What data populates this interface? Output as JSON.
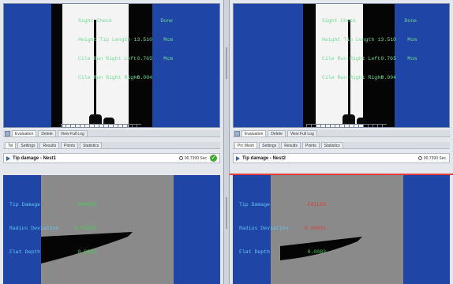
{
  "left": {
    "overlay": [
      {
        "label": "Sight Check",
        "value": "",
        "unit": "Done"
      },
      {
        "label": "Height Tip Length",
        "value": "13.510",
        "unit": "Mcm"
      },
      {
        "label": "Cile Run Right Left",
        "value": "0.765",
        "unit": "Mcm"
      },
      {
        "label": "Cile Run Right Right",
        "value": "-0.004",
        "unit": ""
      }
    ],
    "tabs_top": [
      "Evaluation",
      "Delete",
      "View Full Log"
    ],
    "tabs_bottom": [
      "Tol",
      "Settings",
      "Results",
      "Points",
      "Statistics"
    ],
    "title": "Tip damage - Nest1",
    "time": "00.7390 Sec",
    "status_icon": "check-circle-icon",
    "results": [
      {
        "label": "Tip Damage",
        "value": "PASSED",
        "color": "#44d14f"
      },
      {
        "label": "Radius Deviation",
        "value": "0.00236",
        "color": "#44d14f"
      },
      {
        "label": "Flat Depth",
        "value": "0.0083",
        "color": "#44d14f"
      }
    ]
  },
  "right": {
    "overlay": [
      {
        "label": "Sight Check",
        "value": "",
        "unit": "Done"
      },
      {
        "label": "Height Tip Length",
        "value": "13.510",
        "unit": "Mcm"
      },
      {
        "label": "Cile Run Right Left",
        "value": "0.765",
        "unit": "Mcm"
      },
      {
        "label": "Cile Run Right Right",
        "value": "-0.004",
        "unit": ""
      }
    ],
    "tabs_top": [
      "Evaluation",
      "Delete",
      "View Full Log"
    ],
    "tabs_bottom": [
      "Prc Mesh",
      "Settings",
      "Results",
      "Points",
      "Statistics"
    ],
    "title": "Tip damage - Nest2",
    "time": "00.7390 Sec",
    "results": [
      {
        "label": "Tip Damage",
        "value": "FAILED",
        "color": "#e33b3b"
      },
      {
        "label": "Radius Deviation",
        "value": "0.04831",
        "color": "#e33b3b"
      },
      {
        "label": "Flat Depth",
        "value": "0.0083",
        "color": "#44d14f"
      }
    ]
  }
}
